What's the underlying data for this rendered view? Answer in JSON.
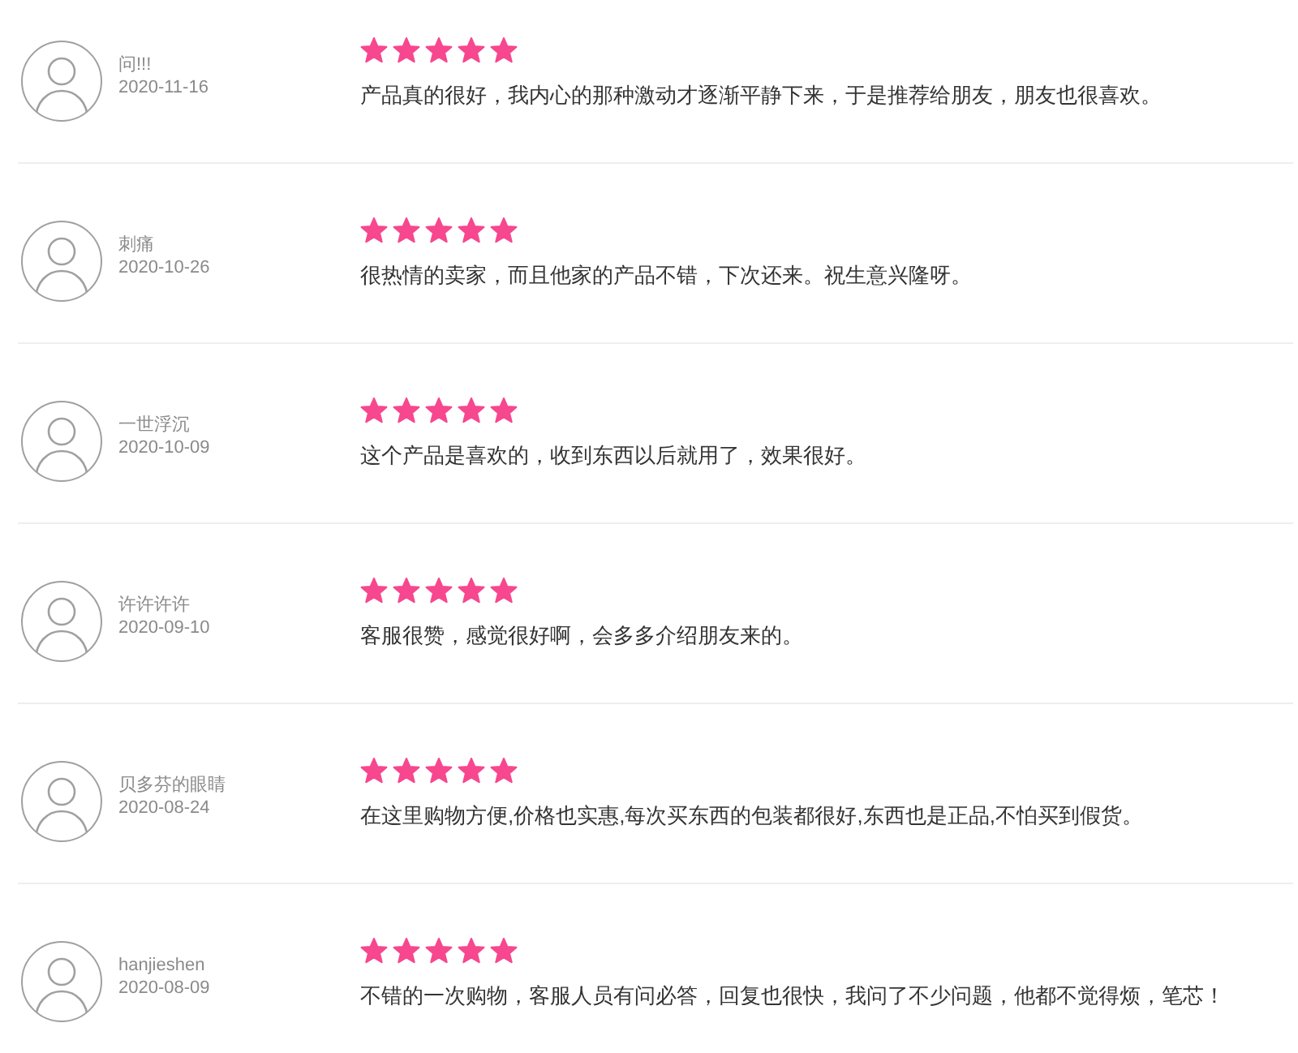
{
  "reviews": [
    {
      "name": "问!!!",
      "date": "2020-11-16",
      "stars": 5,
      "comment": "产品真的很好，我内心的那种激动才逐渐平静下来，于是推荐给朋友，朋友也很喜欢。"
    },
    {
      "name": "刺痛",
      "date": "2020-10-26",
      "stars": 5,
      "comment": "很热情的卖家，而且他家的产品不错，下次还来。祝生意兴隆呀。"
    },
    {
      "name": "一世浮沉",
      "date": "2020-10-09",
      "stars": 5,
      "comment": "这个产品是喜欢的，收到东西以后就用了，效果很好。"
    },
    {
      "name": "许许许许",
      "date": "2020-09-10",
      "stars": 5,
      "comment": "客服很赞，感觉很好啊，会多多介绍朋友来的。"
    },
    {
      "name": "贝多芬的眼睛",
      "date": "2020-08-24",
      "stars": 5,
      "comment": "在这里购物方便,价格也实惠,每次买东西的包装都很好,东西也是正品,不怕买到假货。"
    },
    {
      "name": "hanjieshen",
      "date": "2020-08-09",
      "stars": 5,
      "comment": "不错的一次购物，客服人员有问必答，回复也很快，我问了不少问题，他都不觉得烦，笔芯！"
    }
  ]
}
